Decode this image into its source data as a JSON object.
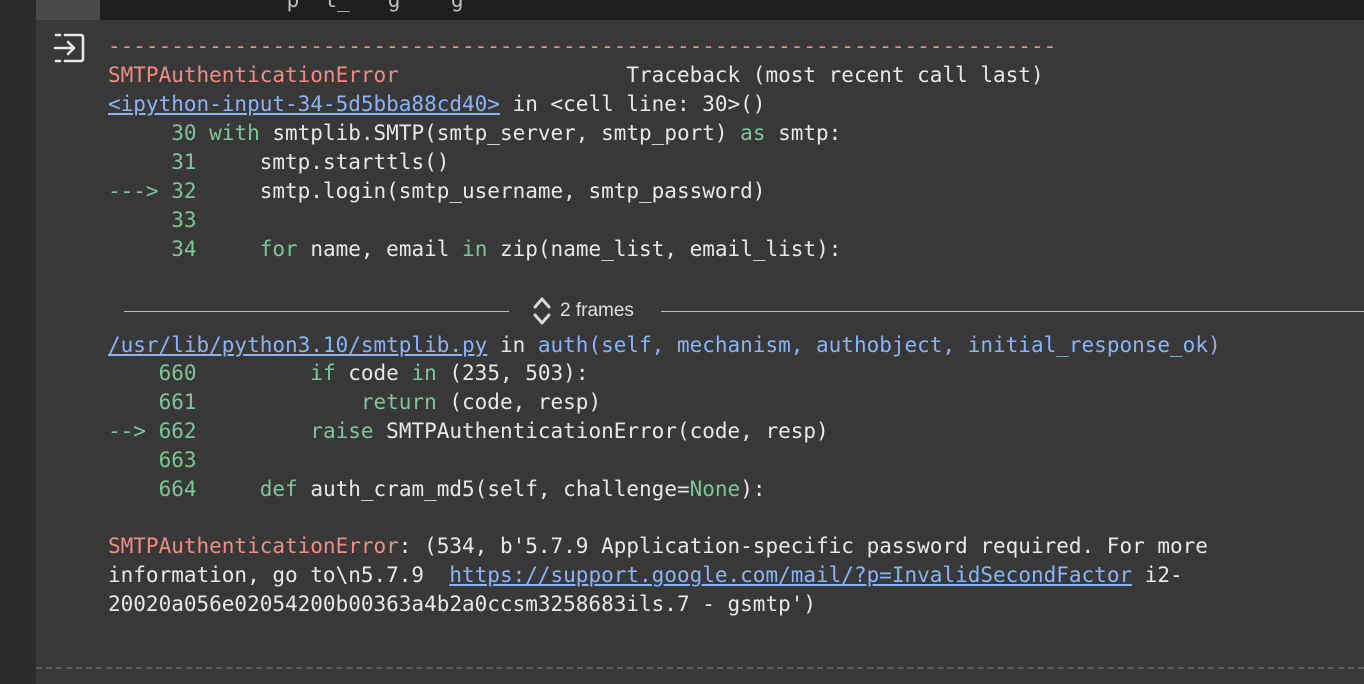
{
  "topbar": {
    "partial_text": "    p  t_   g    g  "
  },
  "traceback": {
    "separator": "---------------------------------------------------------------------------",
    "error_name": "SMTPAuthenticationError",
    "header_right": "Traceback (most recent call last)",
    "frame1": {
      "file_link": "<ipython-input-34-5d5bba88cd40>",
      "in_text": " in <cell line: 30>()",
      "lines": {
        "l30": {
          "no": "     30 ",
          "kw": "with",
          "code": " smtplib.SMTP(smtp_server, smtp_port) ",
          "kw2": "as",
          "code2": " smtp:"
        },
        "l31": {
          "no": "     31 ",
          "code": "    smtp.starttls()"
        },
        "l32": {
          "arrow": "---> ",
          "no": "32 ",
          "code": "    smtp.login(smtp_username, smtp_password)"
        },
        "l33": {
          "no": "     33 "
        },
        "l34": {
          "no": "     34 ",
          "kw": "    for",
          "code": " name, email ",
          "kw2": "in",
          "code2": " zip(name_list, email_list):"
        }
      }
    },
    "frames_toggle": {
      "label": "2 frames"
    },
    "frame2": {
      "file_link": "/usr/lib/python3.10/smtplib.py",
      "in_text": " in ",
      "func_sig": "auth(self, mechanism, authobject, initial_response_ok)",
      "lines": {
        "l660": {
          "no": "    660 ",
          "kw": "        if",
          "code": " code ",
          "kw2": "in",
          "code2": " (235, 503):"
        },
        "l661": {
          "no": "    661 ",
          "kw": "            return",
          "code": " (code, resp)"
        },
        "l662": {
          "arrow": "--> ",
          "no": "662 ",
          "kw": "        raise",
          "code": " SMTPAuthenticationError(code, resp)"
        },
        "l663": {
          "no": "    663 "
        },
        "l664": {
          "no": "    664 ",
          "kw": "    def",
          "code": " auth_cram_md5(self, challenge=",
          "kw2": "None",
          "code2": "):"
        }
      }
    },
    "message": {
      "error_name": "SMTPAuthenticationError",
      "line1_rest": ": (534, b'5.7.9 Application-specific password required. For more",
      "line2_start": "information, go to\\n5.7.9  ",
      "link": "https://support.google.com/mail/?p=InvalidSecondFactor",
      "line2_end": " i2-",
      "line3": "20020a056e02054200b00363a4b2a0ccsm3258683ils.7 - gsmtp')"
    }
  },
  "colors": {
    "background": "#383838",
    "error": "#f28b82",
    "keyword": "#7ec699",
    "link": "#8ab4f8"
  },
  "icons": {
    "output": "exit-to-app-icon",
    "frames": "unfold-more-icon"
  }
}
